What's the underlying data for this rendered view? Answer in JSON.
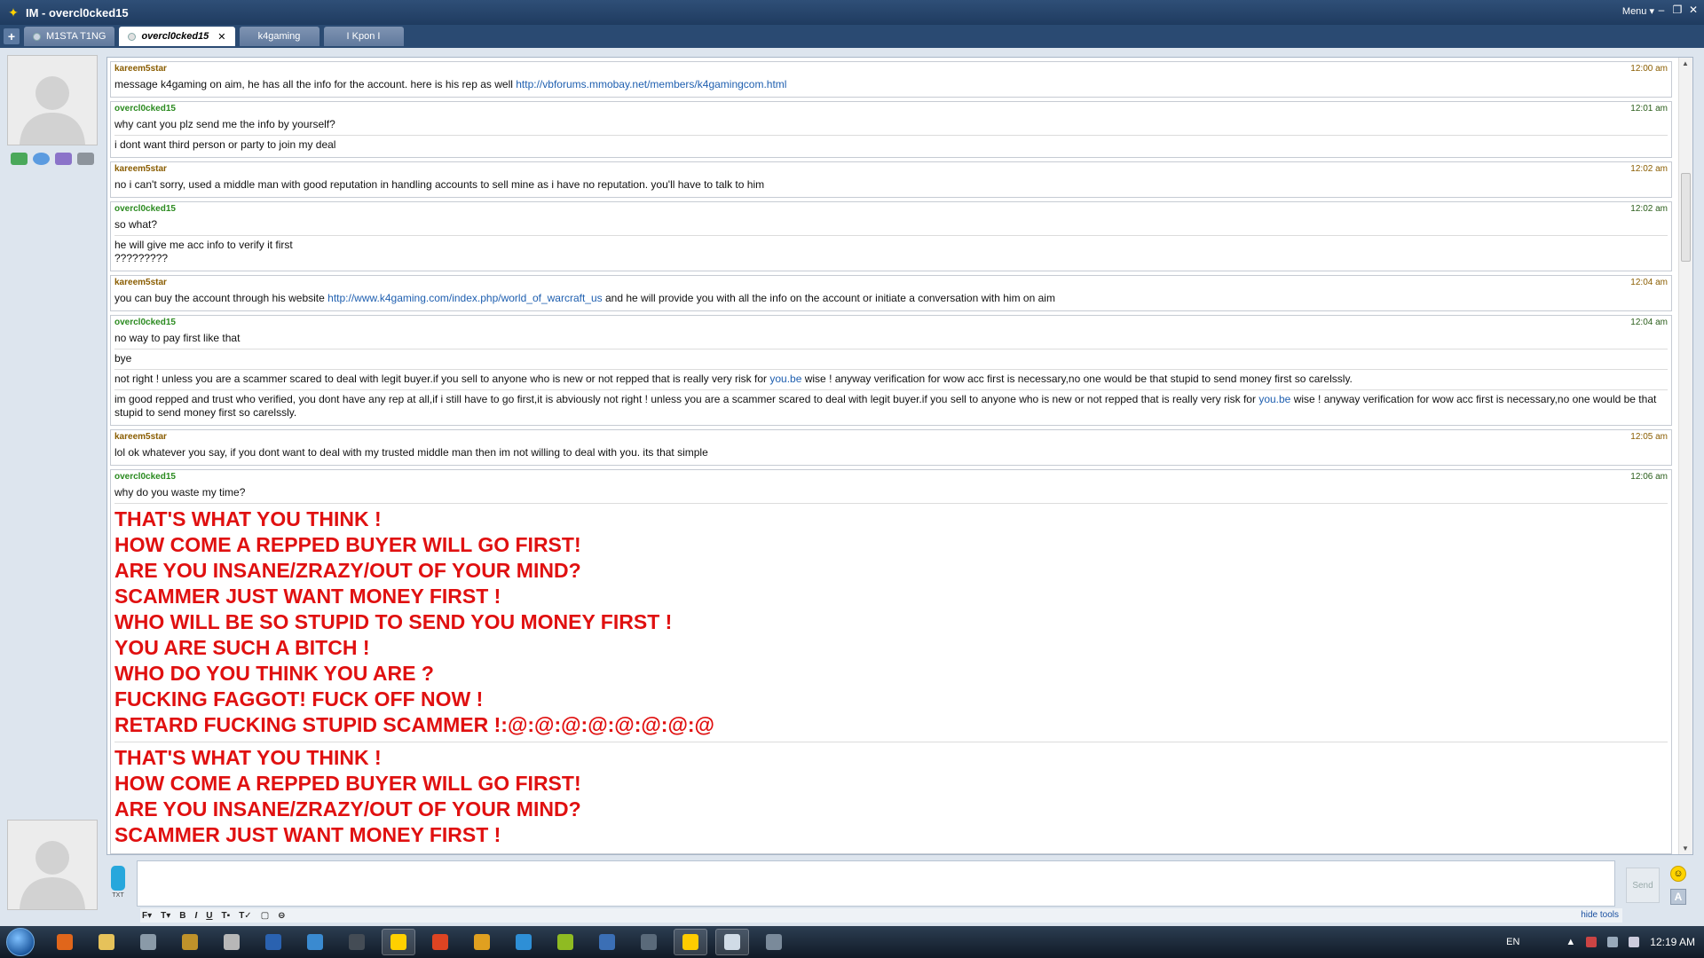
{
  "window": {
    "title": "IM - overcl0cked15",
    "menu_label": "Menu ▾",
    "controls": [
      "–",
      "❐",
      "✕"
    ]
  },
  "tabs": [
    {
      "label": "M1STA T1NG",
      "active": false
    },
    {
      "label": "overcl0cked15",
      "active": true
    },
    {
      "label": "k4gaming",
      "active": false
    },
    {
      "label": "I Kpon I",
      "active": false
    }
  ],
  "messages": [
    {
      "sender": "kareem5star",
      "time": "12:00 am",
      "lines": [
        [
          {
            "t": "message k4gaming on aim, he has all the info for the account. here is his rep as well "
          },
          {
            "t": "http://vbforums.mmobay.net/members/k4gamingcom.html",
            "link": true
          }
        ]
      ]
    },
    {
      "sender": "overcl0cked15",
      "time": "12:01 am",
      "lines": [
        [
          {
            "t": "why cant you plz send me the info by yourself?"
          }
        ],
        [
          {
            "t": "i dont want third person or party to join my deal"
          }
        ]
      ]
    },
    {
      "sender": "kareem5star",
      "time": "12:02 am",
      "lines": [
        [
          {
            "t": "no i can't sorry, used a middle man with good reputation in handling accounts to sell mine as i have no reputation. you'll have to talk to him"
          }
        ]
      ]
    },
    {
      "sender": "overcl0cked15",
      "time": "12:02 am",
      "lines": [
        [
          {
            "t": "so what?"
          }
        ],
        [
          {
            "t": "he will give me acc info to verify it first\n?????????"
          }
        ]
      ]
    },
    {
      "sender": "kareem5star",
      "time": "12:04 am",
      "lines": [
        [
          {
            "t": "you can buy the account through his website "
          },
          {
            "t": "http://www.k4gaming.com/index.php/world_of_warcraft_us",
            "link": true
          },
          {
            "t": " and he will provide you with all the info on the account or initiate a conversation with him on aim"
          }
        ]
      ]
    },
    {
      "sender": "overcl0cked15",
      "time": "12:04 am",
      "lines": [
        [
          {
            "t": "no way to pay first like that"
          }
        ],
        [
          {
            "t": "bye"
          }
        ],
        [
          {
            "t": "not right ! unless you are a scammer scared to deal with legit buyer.if you sell to anyone who is new or not repped that is really very risk for "
          },
          {
            "t": "you.be",
            "link": true
          },
          {
            "t": " wise ! anyway verification for wow acc first is necessary,no one would be that stupid to send money first so carelssly."
          }
        ],
        [
          {
            "t": "im good repped and trust who verified, you dont have any rep at all,if i still have to go first,it is abviously not right ! unless you are a scammer scared to deal with legit buyer.if you sell to anyone who is new or not repped that is really very risk for "
          },
          {
            "t": "you.be",
            "link": true
          },
          {
            "t": " wise ! anyway verification for wow acc first is necessary,no one would be that stupid to send money first so carelssly."
          }
        ]
      ]
    },
    {
      "sender": "kareem5star",
      "time": "12:05 am",
      "lines": [
        [
          {
            "t": "lol ok whatever you say, if you dont want to deal with my trusted middle man then im not willing to deal with you. its that simple"
          }
        ]
      ]
    },
    {
      "sender": "overcl0cked15",
      "time": "12:06 am",
      "lines": [
        [
          {
            "t": "why do you waste my time?"
          }
        ],
        [
          {
            "t": "THAT'S WHAT YOU THINK !\nHOW COME A REPPED BUYER WILL GO FIRST!\nARE YOU INSANE/ZRAZY/OUT OF YOUR MIND?\nSCAMMER JUST WANT MONEY FIRST !\nWHO WILL BE SO STUPID TO SEND YOU MONEY FIRST !\nYOU ARE SUCH A BITCH !\nWHO DO YOU THINK YOU ARE ?\nFUCKING FAGGOT! FUCK OFF NOW !\nRETARD FUCKING STUPID SCAMMER !:@:@:@:@:@:@:@:@",
            "big": true
          }
        ],
        [
          {
            "t": "THAT'S WHAT YOU THINK !\nHOW COME A REPPED BUYER WILL GO FIRST!\nARE YOU INSANE/ZRAZY/OUT OF YOUR MIND?\nSCAMMER JUST WANT MONEY FIRST !",
            "big": true
          }
        ]
      ]
    }
  ],
  "composer": {
    "txt_label": "TXT",
    "send_label": "Send",
    "hide_tools_label": "hide tools",
    "format_tools": [
      "F▾",
      "T▾",
      "B",
      "I",
      "U",
      "T▪",
      "T✓",
      "▢",
      "⊖"
    ]
  },
  "taskbar": {
    "language": "EN",
    "clock": "12:19 AM",
    "icons": [
      "firefox-icon",
      "folder-icon",
      "steam-icon",
      "wow-icon",
      "game-icon",
      "l-app-icon",
      "network-icon",
      "terminal-icon",
      "aim-icon",
      "jet-icon",
      "tiles-icon",
      "chrome-icon",
      "h-app-icon",
      "at-icon",
      "monitor-icon",
      "im-icon",
      "notepad-icon",
      "remote-icon"
    ]
  },
  "colors": {
    "sender_kareem": "#8a5d00",
    "sender_over": "#2a8a1f",
    "link": "#2060b0",
    "shout_red": "#e01010"
  }
}
